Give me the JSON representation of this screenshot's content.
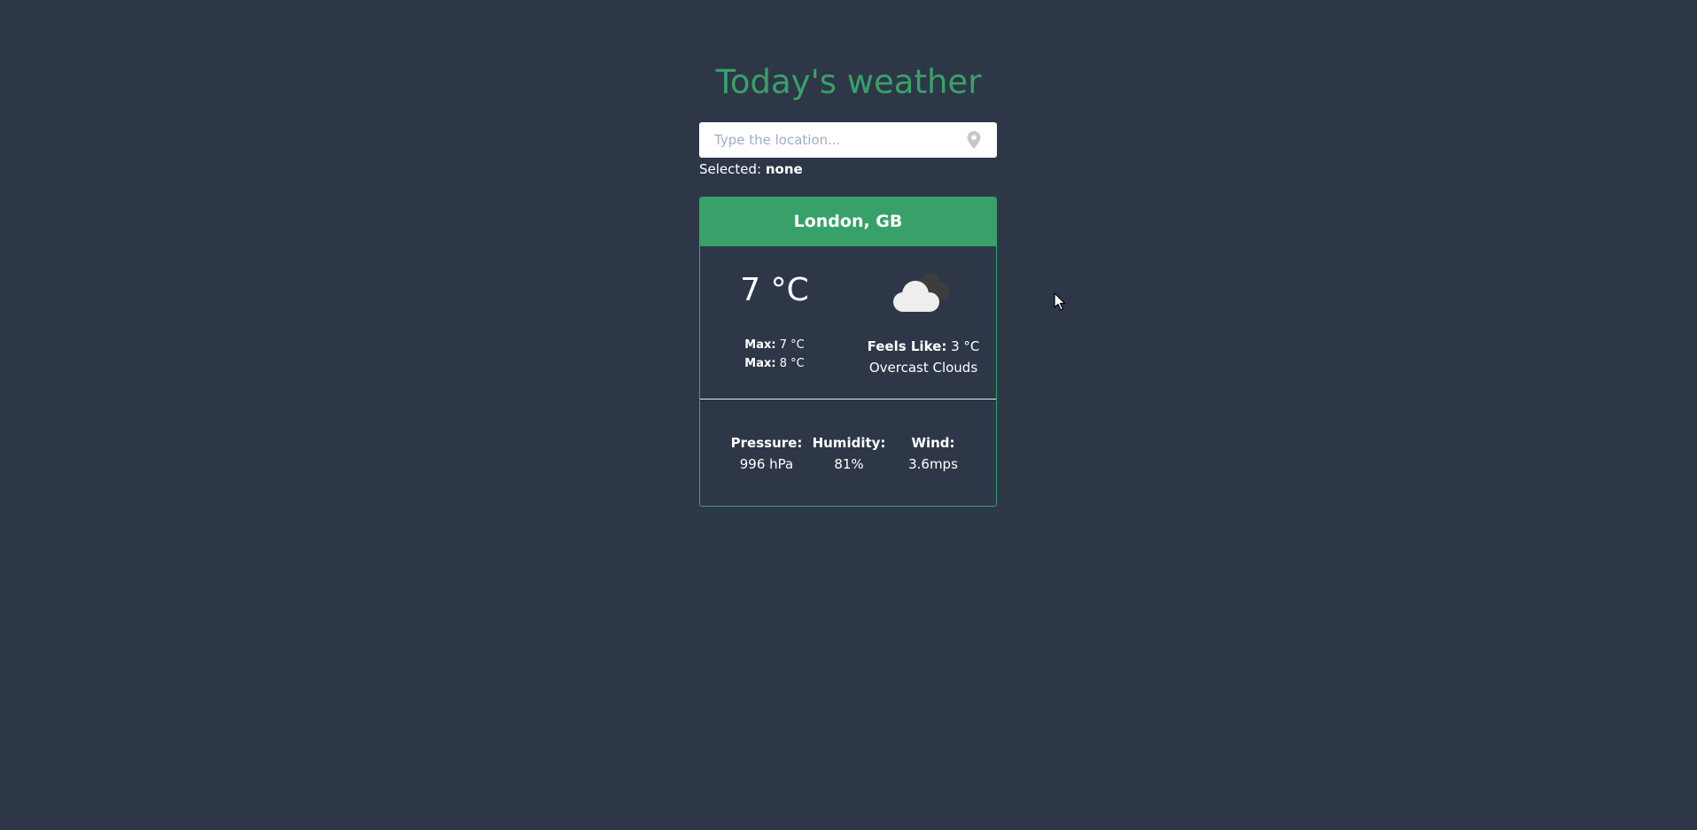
{
  "header": {
    "title": "Today's weather"
  },
  "search": {
    "placeholder": "Type the location...",
    "value": "",
    "icon": "map-pin-icon"
  },
  "selection": {
    "label": "Selected:",
    "value": "none"
  },
  "weather_card": {
    "location": "London, GB",
    "temperature": "7 °C",
    "min_label": "Max:",
    "min_value": "7 °C",
    "max_label": "Max:",
    "max_value": "8 °C",
    "icon": "overcast-clouds-icon",
    "feels_like_label": "Feels Like:",
    "feels_like_value": "3 °C",
    "description": "Overcast Clouds",
    "stats": [
      {
        "label": "Pressure:",
        "value": "996 hPa"
      },
      {
        "label": "Humidity:",
        "value": "81%"
      },
      {
        "label": "Wind:",
        "value": "3.6mps"
      }
    ]
  },
  "colors": {
    "background": "#2e3748",
    "accent": "#38a169",
    "text": "#ffffff"
  }
}
